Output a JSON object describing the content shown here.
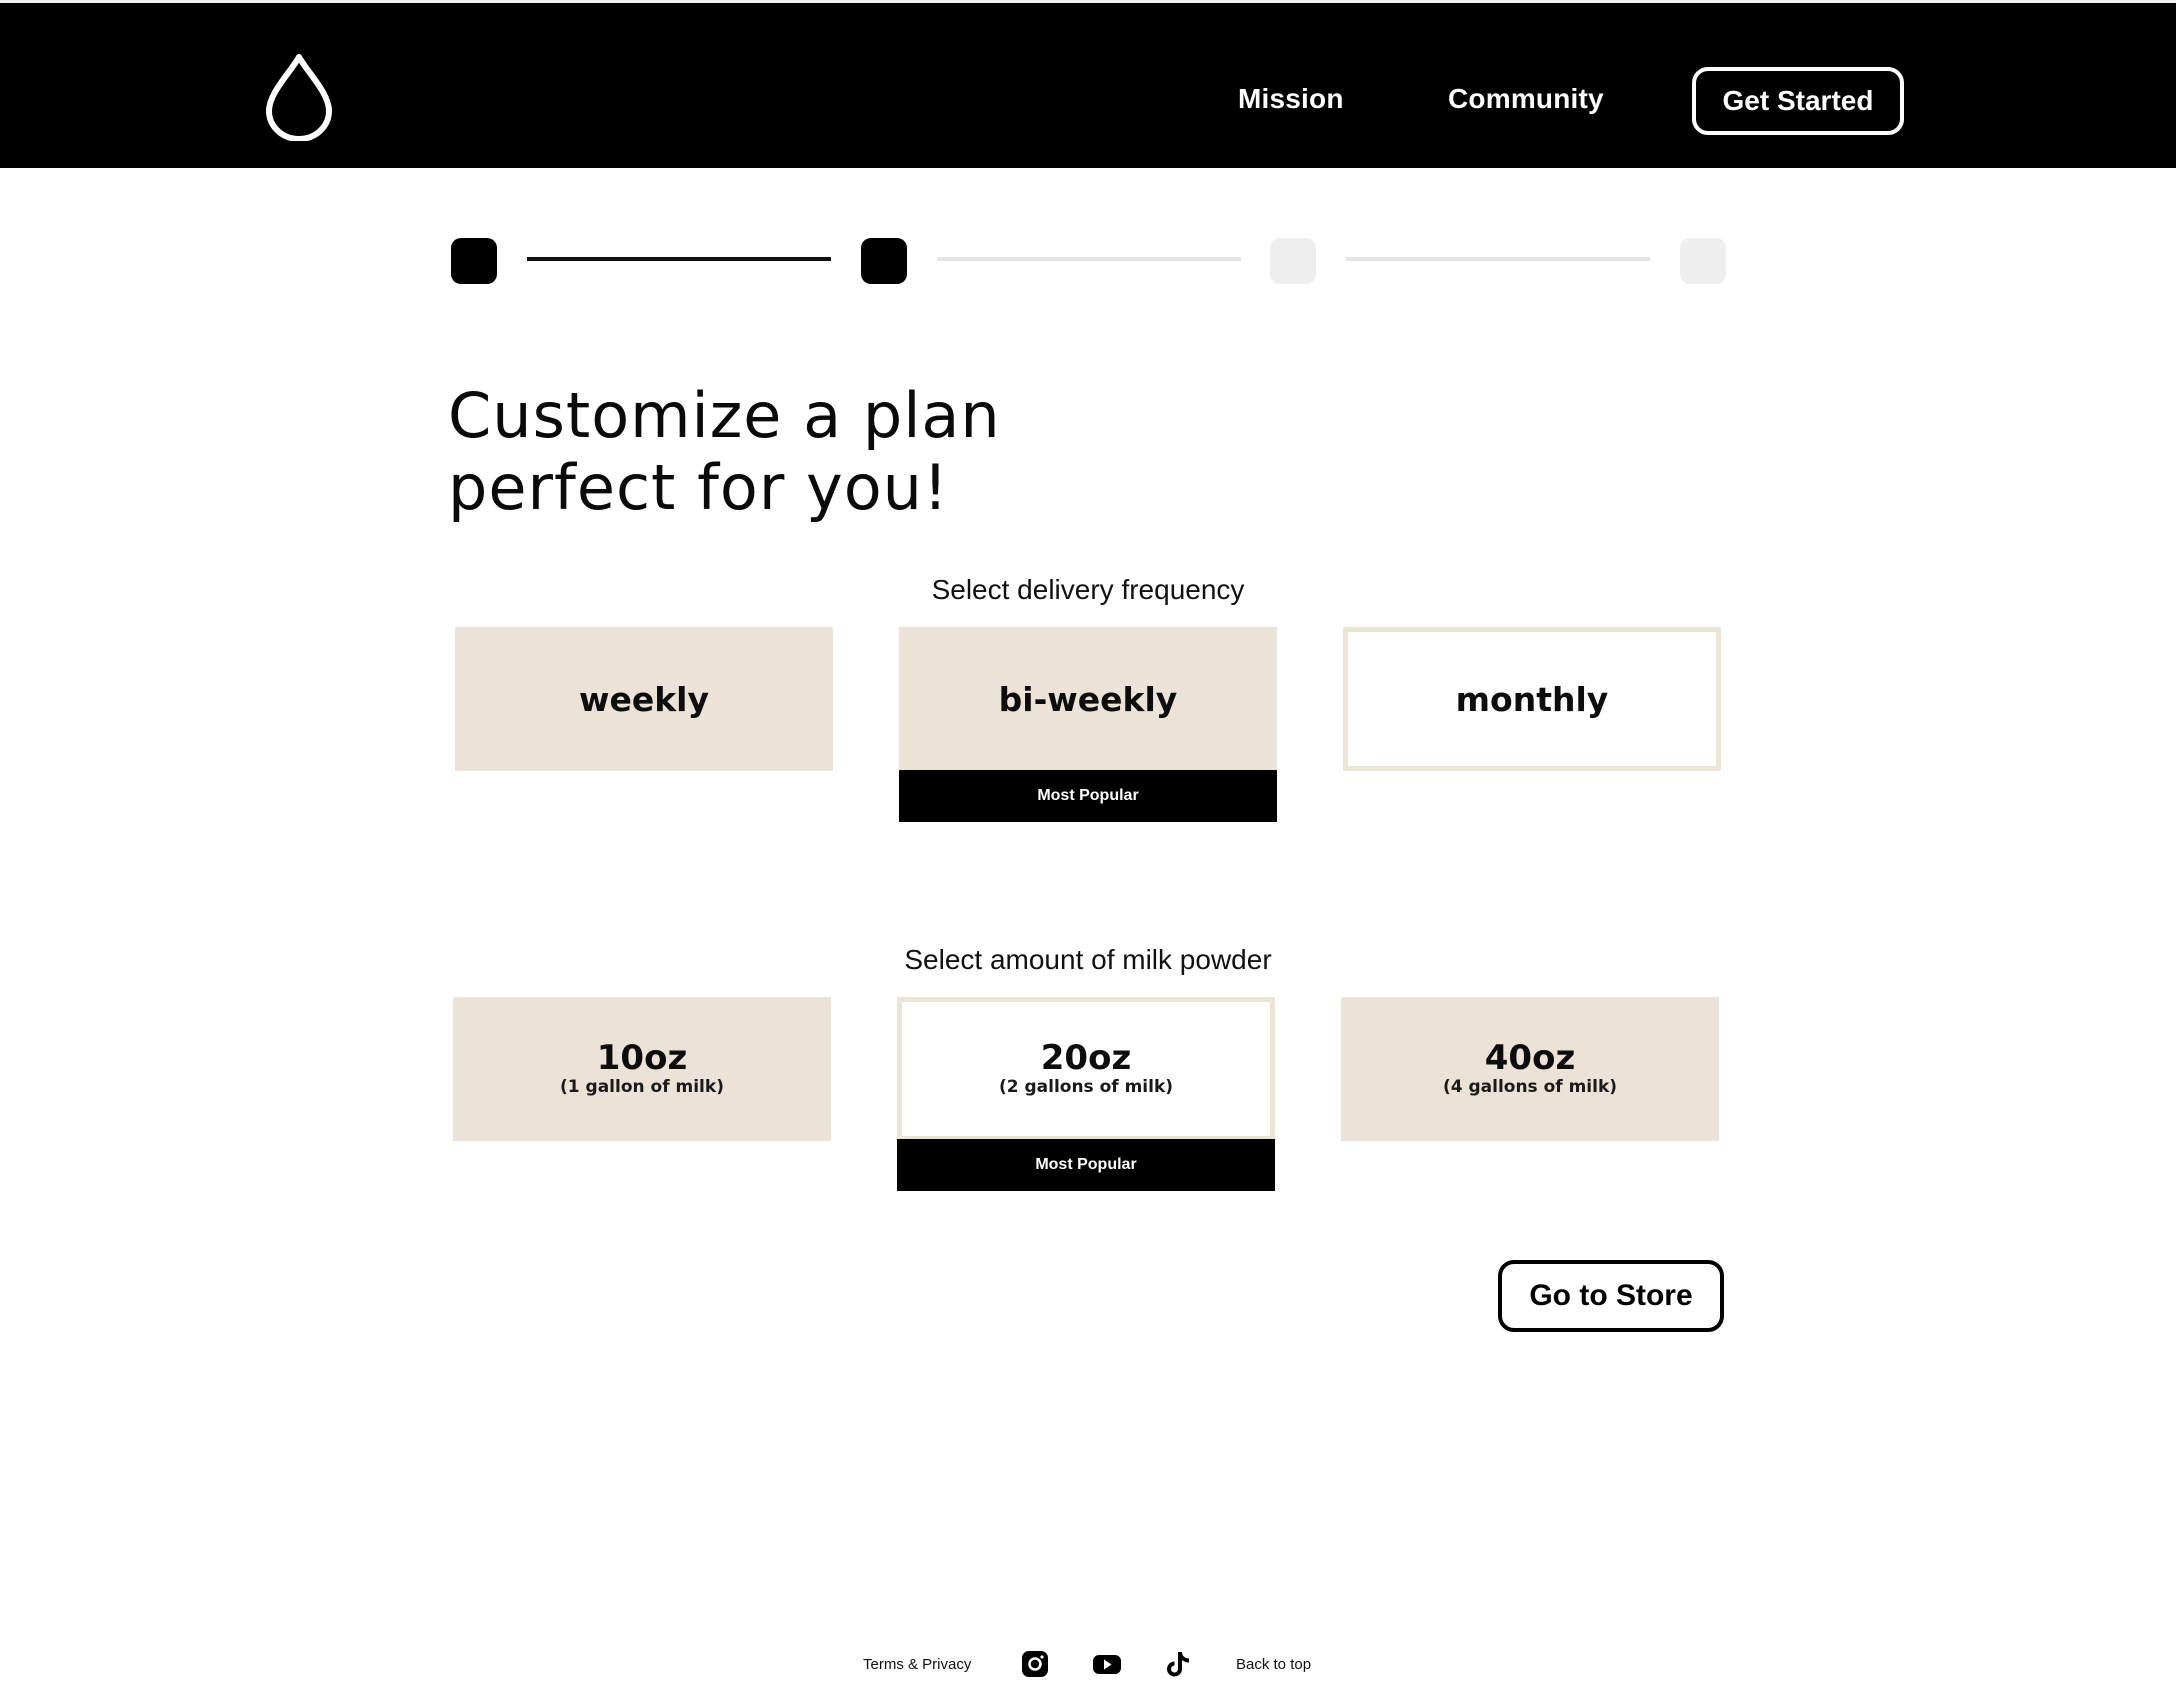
{
  "header": {
    "logo_icon": "water-drop-icon",
    "nav": {
      "mission": "Mission",
      "community": "Community"
    },
    "cta": "Get Started"
  },
  "stepper": {
    "total_steps": 4,
    "current_step": 2
  },
  "title": {
    "line1": "Customize a plan",
    "line2": "perfect for you!"
  },
  "frequency": {
    "label": "Select delivery frequency",
    "options": [
      {
        "name": "weekly"
      },
      {
        "name": "bi-weekly",
        "badge": "Most Popular"
      },
      {
        "name": "monthly",
        "selected": true
      }
    ]
  },
  "amount": {
    "label": "Select amount of milk powder",
    "options": [
      {
        "name": "10oz",
        "sub": "(1 gallon of milk)"
      },
      {
        "name": "20oz",
        "sub": "(2 gallons of milk)",
        "badge": "Most Popular",
        "selected": true
      },
      {
        "name": "40oz",
        "sub": "(4 gallons of milk)"
      }
    ]
  },
  "go_store": "Go to Store",
  "footer": {
    "terms": "Terms & Privacy",
    "back_to_top": "Back to top",
    "social_icons": [
      "instagram-icon",
      "youtube-icon",
      "tiktok-icon"
    ]
  },
  "colors": {
    "header_bg": "#000000",
    "option_beige": "#ebe2d8",
    "option_outline": "#ece5d6",
    "step_inactive": "#eeeeee"
  }
}
